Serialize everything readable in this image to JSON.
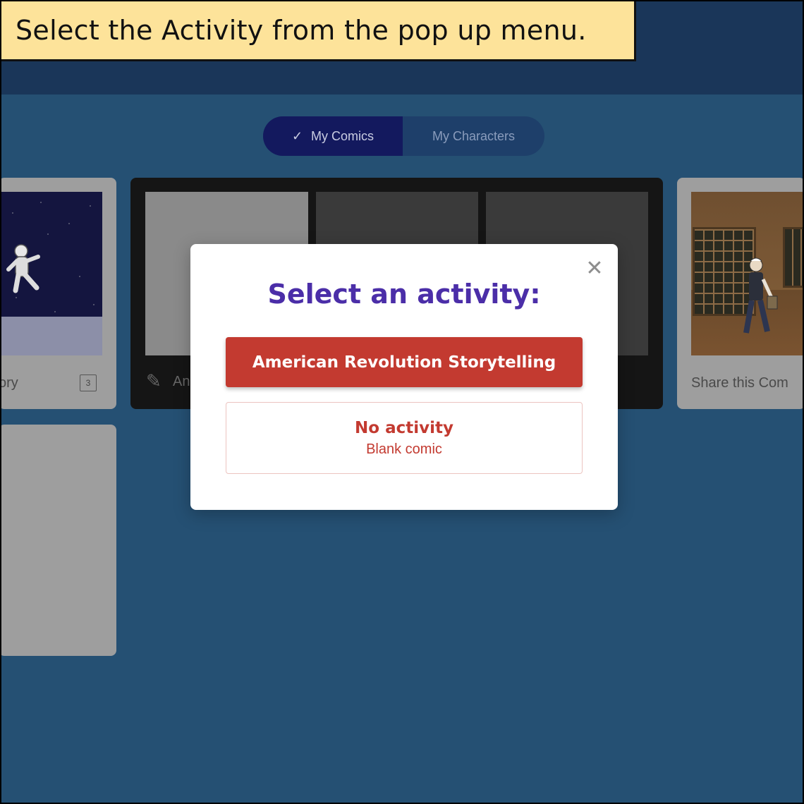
{
  "instruction": {
    "text": "Select the Activity from the pop up menu."
  },
  "toggle": {
    "my_comics": "My Comics",
    "my_characters": "My Characters",
    "check_icon": "check-icon"
  },
  "cards": {
    "left_title": "ory",
    "left_count": "3",
    "mid_title": "An",
    "right_title": "Share this Com"
  },
  "modal": {
    "title": "Select an activity:",
    "activity_button": "American Revolution Storytelling",
    "no_activity_title": "No activity",
    "no_activity_subtitle": "Blank comic",
    "close_icon": "close-icon"
  },
  "colors": {
    "instruction_bg": "#fde39a",
    "topbar": "#1a3659",
    "page_bg": "#255073",
    "modal_title": "#4b2ea8",
    "primary_button": "#c33a30"
  }
}
